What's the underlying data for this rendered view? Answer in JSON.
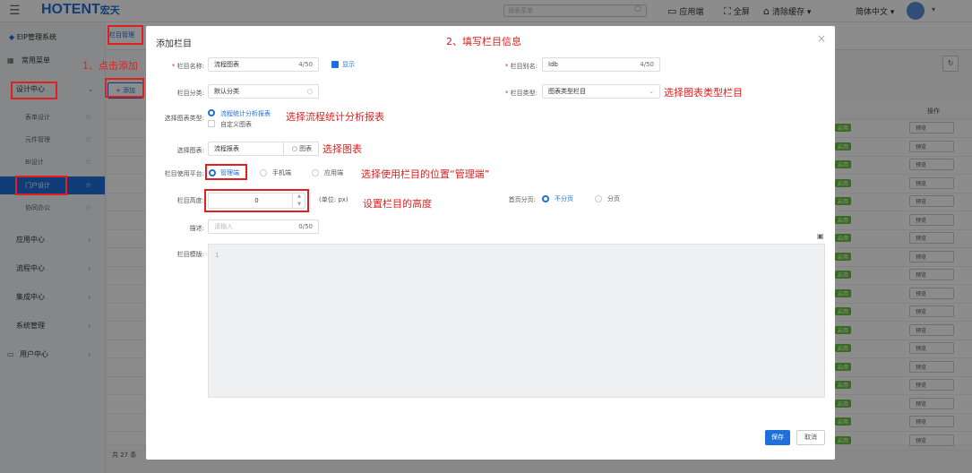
{
  "header": {
    "logo_main": "HOTENT",
    "logo_cn": "宏天",
    "search_placeholder": "搜索菜单",
    "items": [
      "应用端",
      "全屏",
      "清除缓存",
      "简体中文"
    ]
  },
  "sidebar": {
    "system_name": "EIP管理系统",
    "common_menu": "常用菜单",
    "design_center": "设计中心",
    "sub_items": [
      "表单设计",
      "元件管理",
      "BI设计",
      "门户设计",
      "协同办公"
    ],
    "sections": [
      "应用中心",
      "流程中心",
      "集成中心",
      "系统管理",
      "用户中心"
    ]
  },
  "main": {
    "tab_label": "栏目管理",
    "add_button": "+ 添加",
    "total_text": "共 27 条",
    "row_action": "预览",
    "row_status": "启用",
    "col_action": "操作"
  },
  "modal": {
    "title": "添加栏目",
    "fields": {
      "name_label": "栏目名称:",
      "name_value": "流程图表",
      "name_count": "4/50",
      "show_label": "显示",
      "alias_label": "栏目别名:",
      "alias_value": "ldb",
      "alias_count": "4/50",
      "category_label": "栏目分类:",
      "category_value": "默认分类",
      "type_label": "栏目类型:",
      "type_value": "图表类型栏目",
      "chart_type_label": "选择图表类型:",
      "chart_type_opt1": "流程统计分析报表",
      "chart_type_opt2": "自定义图表",
      "chart_label": "选择图表:",
      "chart_value": "流程报表",
      "chart_button": "图表",
      "platform_label": "栏目使用平台:",
      "platform_opts": [
        "管理端",
        "手机端",
        "应用端"
      ],
      "height_label": "栏目高度:",
      "height_value": "0",
      "height_unit": "(单位: px)",
      "paging_label": "首页分页:",
      "paging_opts": [
        "不分页",
        "分页"
      ],
      "desc_label": "描述:",
      "desc_placeholder": "请输入",
      "desc_count": "0/50",
      "template_label": "栏目模版:",
      "editor_line": "1"
    },
    "save": "保存",
    "cancel": "取消"
  },
  "annotations": {
    "a1": "1、点击添加",
    "a2": "2、填写栏目信息",
    "a3": "选择图表类型栏目",
    "a4": "选择流程统计分析报表",
    "a5": "选择图表",
    "a6": "选择使用栏目的位置“管理端”",
    "a7": "设置栏目的高度"
  },
  "colors": {
    "accent": "#1e6fd9",
    "annotation": "#e02020"
  }
}
